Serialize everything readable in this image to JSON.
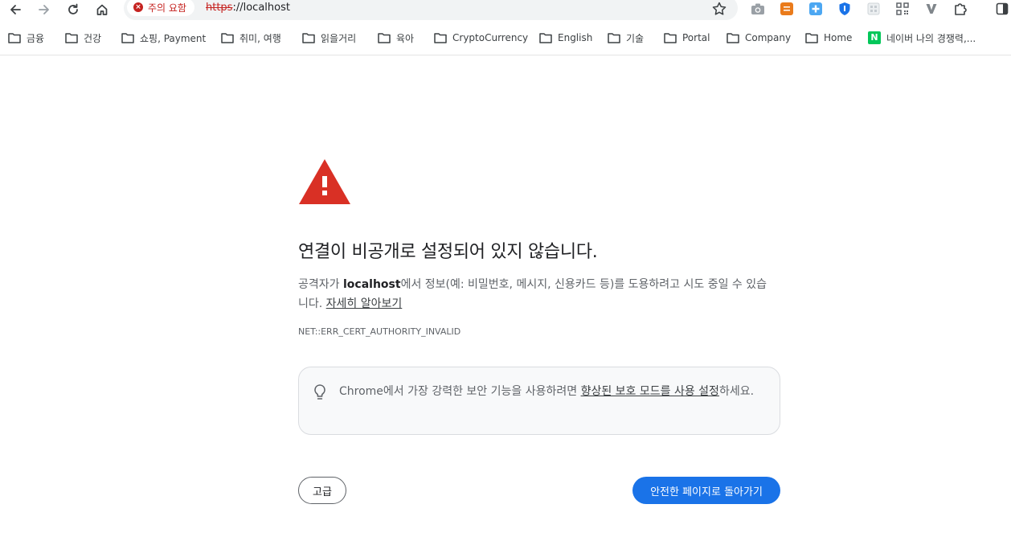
{
  "browser": {
    "security_chip": "주의 요함",
    "url_scheme": "https",
    "url_rest": "://localhost"
  },
  "bookmarks": [
    {
      "label": "금융",
      "icon": "folder-icon"
    },
    {
      "label": "건강",
      "icon": "folder-icon"
    },
    {
      "label": "쇼핑, Payment",
      "icon": "folder-icon"
    },
    {
      "label": "취미, 여행",
      "icon": "folder-icon"
    },
    {
      "label": "읽을거리",
      "icon": "folder-icon"
    },
    {
      "label": "육아",
      "icon": "folder-icon"
    },
    {
      "label": "CryptoCurrency",
      "icon": "folder-icon"
    },
    {
      "label": "English",
      "icon": "folder-icon"
    },
    {
      "label": "기술",
      "icon": "folder-icon"
    },
    {
      "label": "Portal",
      "icon": "folder-icon"
    },
    {
      "label": "Company",
      "icon": "folder-icon"
    },
    {
      "label": "Home",
      "icon": "folder-icon"
    },
    {
      "label": "네이버 나의 경쟁력,...",
      "icon": "naver-icon",
      "icon_text": "N"
    }
  ],
  "page": {
    "title": "연결이 비공개로 설정되어 있지 않습니다.",
    "desc_prefix": "공격자가 ",
    "desc_host": "localhost",
    "desc_middle": "에서 정보(예: 비밀번호, 메시지, 신용카드 등)를 도용하려고 시도 중일 수 있습니다. ",
    "learn_more": "자세히 알아보기",
    "error_code": "NET::ERR_CERT_AUTHORITY_INVALID",
    "tip_prefix": "Chrome에서 가장 강력한 보안 기능을 사용하려면 ",
    "tip_link": "향상된 보호 모드를 사용 설정",
    "tip_suffix": "하세요.",
    "advanced_button": "고급",
    "back_button": "안전한 페이지로 돌아가기"
  },
  "colors": {
    "danger": "#c5221f",
    "warning_triangle": "#d93025",
    "primary_button": "#1a73e8"
  }
}
